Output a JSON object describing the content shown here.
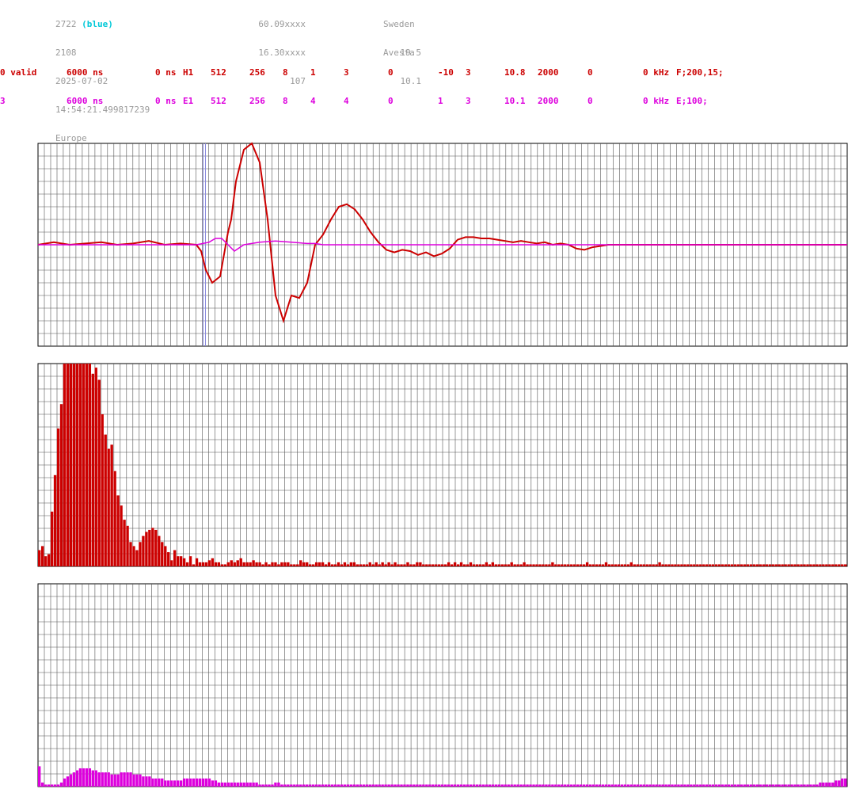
{
  "header": {
    "col1": [
      "2722",
      "2108",
      "2025-07-02",
      "14:54:21.499817239",
      "Europe"
    ],
    "col1_suffix": "(blue)",
    "col2": [
      "60.09xxxx",
      "16.30xxxx",
      "107"
    ],
    "col3": [
      "Sweden",
      "Avesta"
    ],
    "col4": [
      "19.5",
      "10.1"
    ]
  },
  "channels": [
    {
      "color": "#cc0000",
      "fields": [
        "0 valid",
        "6000 ns",
        "0 ns",
        "H1",
        "512",
        "256",
        "8",
        "1",
        "3",
        "0",
        "-10",
        "3",
        "10.8",
        "2000",
        "0",
        "0 kHz",
        "F;200,15;"
      ]
    },
    {
      "color": "#dd00dd",
      "fields": [
        "3",
        "6000 ns",
        "0 ns",
        "E1",
        "512",
        "256",
        "8",
        "4",
        "4",
        "0",
        "1",
        "3",
        "10.1",
        "2000",
        "0",
        "0 kHz",
        "E;100;"
      ]
    }
  ],
  "chart_data": [
    {
      "type": "line",
      "grid": true,
      "ylim": [
        -8,
        8
      ],
      "marker_x": 105,
      "series": [
        {
          "color": "#cc0000",
          "x": [
            0,
            10,
            20,
            30,
            40,
            50,
            60,
            70,
            80,
            90,
            100,
            103,
            106,
            110,
            115,
            120,
            122,
            125,
            130,
            135,
            140,
            145,
            150,
            155,
            160,
            165,
            170,
            175,
            180,
            185,
            190,
            195,
            200,
            205,
            210,
            215,
            220,
            225,
            230,
            235,
            240,
            245,
            250,
            255,
            260,
            265,
            270,
            275,
            280,
            285,
            290,
            295,
            300,
            305,
            310,
            315,
            320,
            325,
            330,
            335,
            340,
            345,
            350,
            355,
            360,
            365,
            370,
            375,
            380,
            385,
            390,
            395,
            400,
            405,
            410,
            415,
            420,
            425,
            430,
            435,
            440,
            445,
            450,
            455,
            460,
            465,
            470,
            475,
            480,
            485,
            490,
            495,
            500,
            505,
            510,
            511
          ],
          "y": [
            0,
            0.2,
            0,
            0.1,
            0.2,
            0,
            0.1,
            0.3,
            0,
            0.1,
            0,
            -0.5,
            -2,
            -3,
            -2.5,
            1,
            2,
            5,
            7.5,
            8,
            6.5,
            2,
            -4,
            -6,
            -4,
            -4.2,
            -3,
            0,
            0.8,
            2,
            3,
            3.2,
            2.8,
            2,
            1,
            0.2,
            -0.4,
            -0.6,
            -0.4,
            -0.5,
            -0.8,
            -0.6,
            -0.9,
            -0.7,
            -0.3,
            0.4,
            0.6,
            0.6,
            0.5,
            0.5,
            0.4,
            0.3,
            0.2,
            0.3,
            0.2,
            0.1,
            0.2,
            0,
            0.1,
            0,
            -0.3,
            -0.4,
            -0.2,
            -0.1,
            0,
            0,
            0,
            0,
            0,
            0,
            0,
            0,
            0,
            0,
            0,
            0,
            0,
            0,
            0,
            0,
            0,
            0,
            0,
            0,
            0,
            0,
            0,
            0,
            0,
            0,
            0,
            0,
            0,
            0,
            0,
            0
          ]
        },
        {
          "color": "#dd00dd",
          "x": [
            0,
            50,
            100,
            108,
            112,
            116,
            120,
            124,
            130,
            140,
            150,
            160,
            170,
            175,
            180,
            190,
            200,
            250,
            300,
            350,
            400,
            450,
            511
          ],
          "y": [
            0,
            0,
            0,
            0.2,
            0.5,
            0.5,
            0,
            -0.5,
            0,
            0.2,
            0.3,
            0.2,
            0.1,
            0.1,
            0,
            0,
            0,
            0,
            0,
            0,
            0,
            0,
            0
          ]
        }
      ]
    },
    {
      "type": "bar",
      "grid": true,
      "ylim": [
        0,
        100
      ],
      "series": [
        {
          "color": "#cc0000",
          "values": [
            8,
            10,
            5,
            6,
            27,
            45,
            68,
            80,
            100,
            100,
            100,
            100,
            100,
            100,
            100,
            100,
            100,
            95,
            98,
            92,
            75,
            65,
            58,
            60,
            47,
            35,
            30,
            23,
            20,
            12,
            10,
            8,
            12,
            15,
            17,
            18,
            19,
            18,
            15,
            12,
            10,
            7,
            3,
            8,
            5,
            5,
            4,
            2,
            5,
            1,
            4,
            2,
            2,
            2,
            3,
            4,
            2,
            2,
            1,
            1,
            2,
            3,
            2,
            3,
            4,
            2,
            2,
            2,
            3,
            2,
            2,
            1,
            2,
            1,
            2,
            2,
            1,
            2,
            2,
            2,
            1,
            1,
            1,
            3,
            2,
            2,
            1,
            1,
            2,
            2,
            2,
            1,
            2,
            1,
            1,
            2,
            1,
            2,
            1,
            2,
            2,
            1,
            1,
            1,
            1,
            2,
            1,
            2,
            1,
            2,
            1,
            2,
            1,
            2,
            1,
            1,
            1,
            2,
            1,
            1,
            2,
            2,
            1,
            1,
            1,
            1,
            1,
            1,
            1,
            1,
            2,
            1,
            2,
            1,
            2,
            1,
            1,
            2,
            1,
            1,
            1,
            1,
            2,
            1,
            2,
            1,
            1,
            1,
            1,
            1,
            2,
            1,
            1,
            1,
            2,
            1,
            1,
            1,
            1,
            1,
            1,
            1,
            1,
            2,
            1,
            1,
            1,
            1,
            1,
            1,
            1,
            1,
            1,
            1,
            2,
            1,
            1,
            1,
            1,
            1,
            2,
            1,
            1,
            1,
            1,
            1,
            1,
            1,
            2,
            1,
            1,
            1,
            1,
            1,
            1,
            1,
            1,
            2,
            1,
            1,
            1,
            1,
            1,
            1,
            1,
            1,
            1,
            1,
            1,
            1,
            1,
            1,
            1,
            1,
            1,
            1,
            1,
            1,
            1,
            1,
            1,
            1,
            1,
            1,
            1,
            1,
            1,
            1,
            1,
            1,
            1,
            1,
            1,
            1,
            1,
            1,
            1,
            1,
            1,
            1,
            1,
            1,
            1,
            1,
            1,
            1,
            1,
            1,
            1,
            1,
            1,
            1,
            1,
            1,
            1,
            1,
            1
          ]
        }
      ]
    },
    {
      "type": "bar",
      "grid": true,
      "ylim": [
        0,
        100
      ],
      "series": [
        {
          "color": "#dd00dd",
          "values": [
            10,
            2,
            1,
            1,
            1,
            1,
            1,
            2,
            4,
            5,
            6,
            7,
            8,
            9,
            9,
            9,
            9,
            8,
            8,
            7,
            7,
            7,
            7,
            6,
            6,
            6,
            7,
            7,
            7,
            7,
            6,
            6,
            6,
            5,
            5,
            5,
            4,
            4,
            4,
            4,
            3,
            3,
            3,
            3,
            3,
            3,
            4,
            4,
            4,
            4,
            4,
            4,
            4,
            4,
            4,
            3,
            3,
            2,
            2,
            2,
            2,
            2,
            2,
            2,
            2,
            2,
            2,
            2,
            2,
            2,
            1,
            1,
            1,
            1,
            1,
            2,
            2,
            1,
            1,
            1,
            1,
            1,
            1,
            1,
            1,
            1,
            1,
            1,
            1,
            1,
            1,
            1,
            1,
            1,
            1,
            1,
            1,
            1,
            1,
            1,
            1,
            1,
            1,
            1,
            1,
            1,
            1,
            1,
            1,
            1,
            1,
            1,
            1,
            1,
            1,
            1,
            1,
            1,
            1,
            1,
            1,
            1,
            1,
            1,
            1,
            1,
            1,
            1,
            1,
            1,
            1,
            1,
            1,
            1,
            1,
            1,
            1,
            1,
            1,
            1,
            1,
            1,
            1,
            1,
            1,
            1,
            1,
            1,
            1,
            1,
            1,
            1,
            1,
            1,
            1,
            1,
            1,
            1,
            1,
            1,
            1,
            1,
            1,
            1,
            1,
            1,
            1,
            1,
            1,
            1,
            1,
            1,
            1,
            1,
            1,
            1,
            1,
            1,
            1,
            1,
            1,
            1,
            1,
            1,
            1,
            1,
            1,
            1,
            1,
            1,
            1,
            1,
            1,
            1,
            1,
            1,
            1,
            1,
            1,
            1,
            1,
            1,
            1,
            1,
            1,
            1,
            1,
            1,
            1,
            1,
            1,
            1,
            1,
            1,
            1,
            1,
            1,
            1,
            1,
            1,
            1,
            1,
            1,
            1,
            1,
            1,
            1,
            1,
            1,
            1,
            1,
            1,
            1,
            1,
            1,
            1,
            1,
            1,
            1,
            1,
            1,
            1,
            1,
            1,
            1,
            1,
            1,
            1,
            2,
            2,
            2,
            2,
            2,
            3,
            3,
            4,
            4
          ]
        }
      ]
    }
  ]
}
